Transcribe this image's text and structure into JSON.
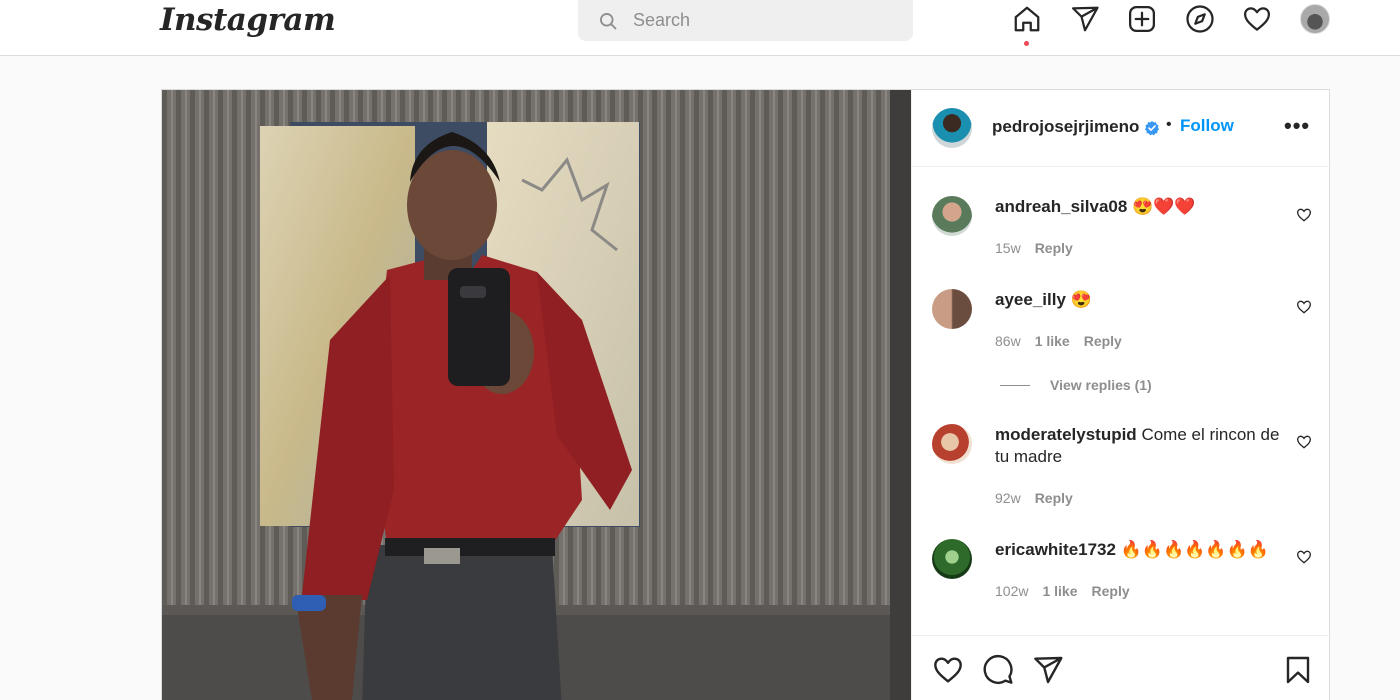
{
  "topbar": {
    "logo": "Instagram",
    "search_placeholder": "Search",
    "icons": [
      "home-icon",
      "direct-icon",
      "new-post-icon",
      "explore-icon",
      "activity-icon",
      "profile-avatar"
    ]
  },
  "post": {
    "author": "pedrojosejrjimeno",
    "verified": true,
    "separator": "•",
    "follow_label": "Follow",
    "more_label": "•••",
    "comments": [
      {
        "user": "andreah_silva08",
        "text": "😍❤️❤️",
        "age": "15w",
        "likes": "",
        "reply_label": "Reply"
      },
      {
        "user": "ayee_illy",
        "text": "😍",
        "age": "86w",
        "likes": "1 like",
        "reply_label": "Reply",
        "view_replies": "View replies (1)"
      },
      {
        "user": "moderatelystupid",
        "text": "Come el rincon de tu madre",
        "age": "92w",
        "likes": "",
        "reply_label": "Reply"
      },
      {
        "user": "ericawhite1732",
        "text": "🔥🔥🔥🔥🔥🔥🔥",
        "age": "102w",
        "likes": "1 like",
        "reply_label": "Reply"
      }
    ]
  },
  "colors": {
    "accent": "#0095f6",
    "notification_dot": "#ed4956",
    "muted_text": "#8e8e8e",
    "border": "#dbdbdb"
  }
}
